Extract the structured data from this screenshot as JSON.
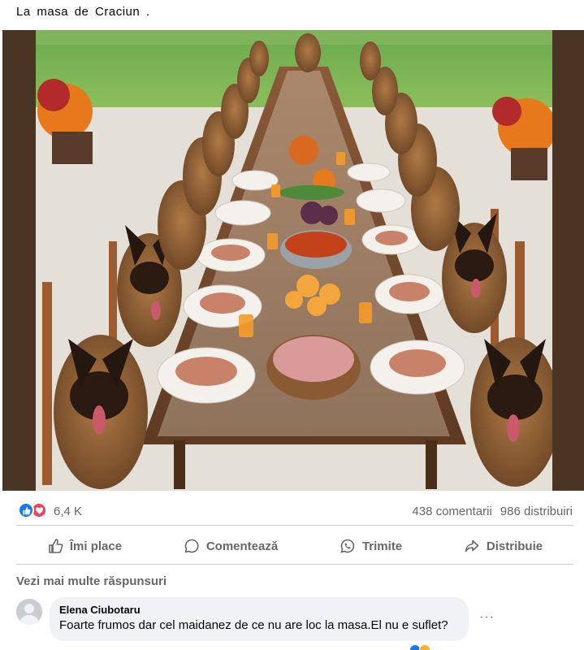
{
  "post": {
    "caption": "La masa de Craciun ."
  },
  "colors": {
    "like_blue": "#1877f2",
    "love_red": "#f33e58",
    "muted_text": "#65676b",
    "comment_bg": "#f0f2f5"
  },
  "reactions": {
    "count": "6,4 K",
    "icons": [
      "like-icon",
      "love-icon"
    ]
  },
  "stats": {
    "comments": "438 comentarii",
    "shares": "986 distribuiri"
  },
  "actions": {
    "like": "Îmi place",
    "comment": "Comentează",
    "send": "Trimite",
    "share": "Distribuie"
  },
  "more_replies": "Vezi mai multe răspunsuri",
  "comment": {
    "author": "Elena Ciubotaru",
    "text": "Foarte frumos dar cel maidanez de ce nu are loc la masa.El nu e suflet?",
    "more": "···"
  }
}
